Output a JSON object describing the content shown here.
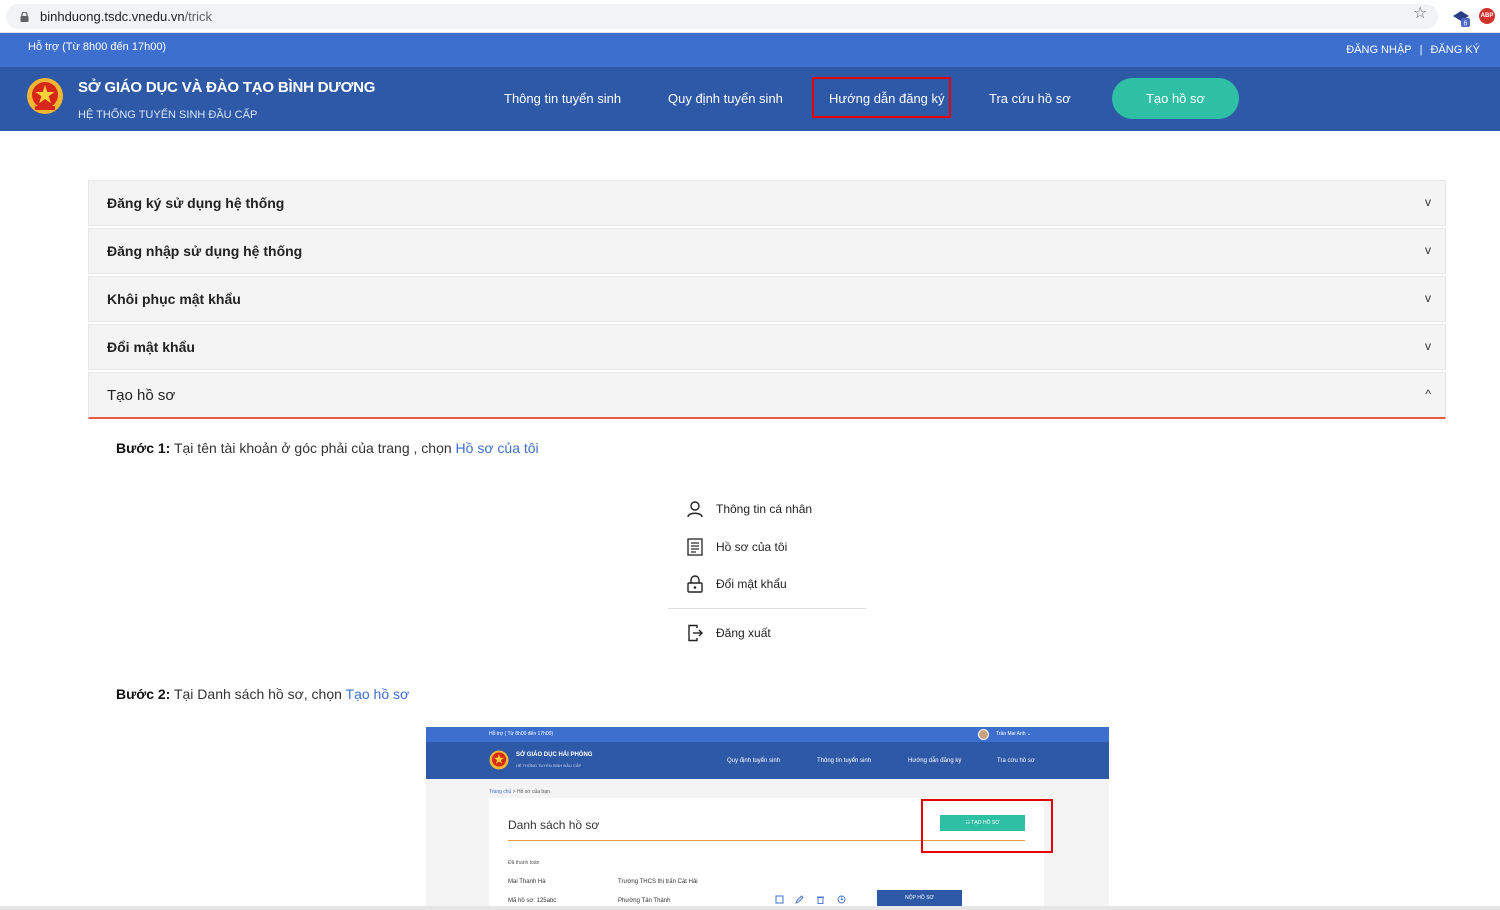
{
  "browser": {
    "url_host": "binhduong.tsdc.vnedu.vn",
    "url_path": "/trick",
    "ext_badge": "6",
    "ext_abp": "ABP"
  },
  "topbar": {
    "support": "Hỗ trợ (Từ 8h00 đến 17h00)",
    "login": "ĐĂNG NHẬP",
    "separator": "|",
    "register": "ĐĂNG KÝ"
  },
  "header": {
    "org": "SỞ GIÁO DỤC VÀ ĐÀO TẠO BÌNH DƯƠNG",
    "system": "HỆ THỐNG TUYỂN SINH ĐẦU CẤP",
    "nav": [
      "Thông tin tuyển sinh",
      "Quy định tuyển sinh",
      "Hướng dẫn đăng ký",
      "Tra cứu hồ sơ"
    ],
    "cta": "Tạo hồ sơ"
  },
  "accordion": {
    "items": [
      {
        "title": "Đăng ký sử dụng hệ thống",
        "chevron": "v"
      },
      {
        "title": "Đăng nhập sử dụng hệ thống",
        "chevron": "v"
      },
      {
        "title": "Khôi phục mật khẩu",
        "chevron": "v"
      },
      {
        "title": "Đổi mật khẩu",
        "chevron": "v"
      },
      {
        "title": "Tạo hồ sơ",
        "chevron": "^"
      }
    ]
  },
  "steps": {
    "step1_label": "Bước 1:",
    "step1_text": " Tại tên tài khoản ở góc phải của trang , chọn ",
    "step1_link": "Hồ sơ của tôi",
    "step2_label": "Bước 2:",
    "step2_text": " Tại Danh sách hồ sơ, chọn ",
    "step2_link": "Tạo hồ sơ"
  },
  "user_menu": {
    "items": [
      {
        "label": "Thông tin cá nhân",
        "icon": "user-icon"
      },
      {
        "label": "Hồ sơ của tôi",
        "icon": "document-list-icon"
      },
      {
        "label": "Đổi mật khẩu",
        "icon": "lock-icon"
      },
      {
        "label": "Đăng xuất",
        "icon": "logout-icon"
      }
    ]
  },
  "embedded_screenshot": {
    "support": "Hỗ trợ ( Từ 8h00 đến 17h00)",
    "user": "Trần Mai Anh ⌄",
    "org": "SỞ GIÁO DỤC HẢI PHÒNG",
    "system": "HỆ THỐNG TUYỂN SINH ĐẦU CẤP",
    "nav": [
      "Quy định tuyển sinh",
      "Thông tin tuyển sinh",
      "Hướng dẫn đăng ký",
      "Tra cứu hồ sơ"
    ],
    "crumb_home": "Trang chủ",
    "crumb_sep": " > ",
    "crumb_current": "Hồ sơ của bạn",
    "list_title": "Danh sách hồ sơ",
    "create_button": "☷  TẠO HỒ SƠ",
    "status": "Đã thanh toán",
    "student_name": "Mai Thanh Hà",
    "school": "Trường THCS thị trấn Cát Hải",
    "file_code": "Mã hồ sơ: 125abc",
    "ward": "Phường Tân Thành",
    "submit_button": "NỘP HỒ SƠ"
  }
}
